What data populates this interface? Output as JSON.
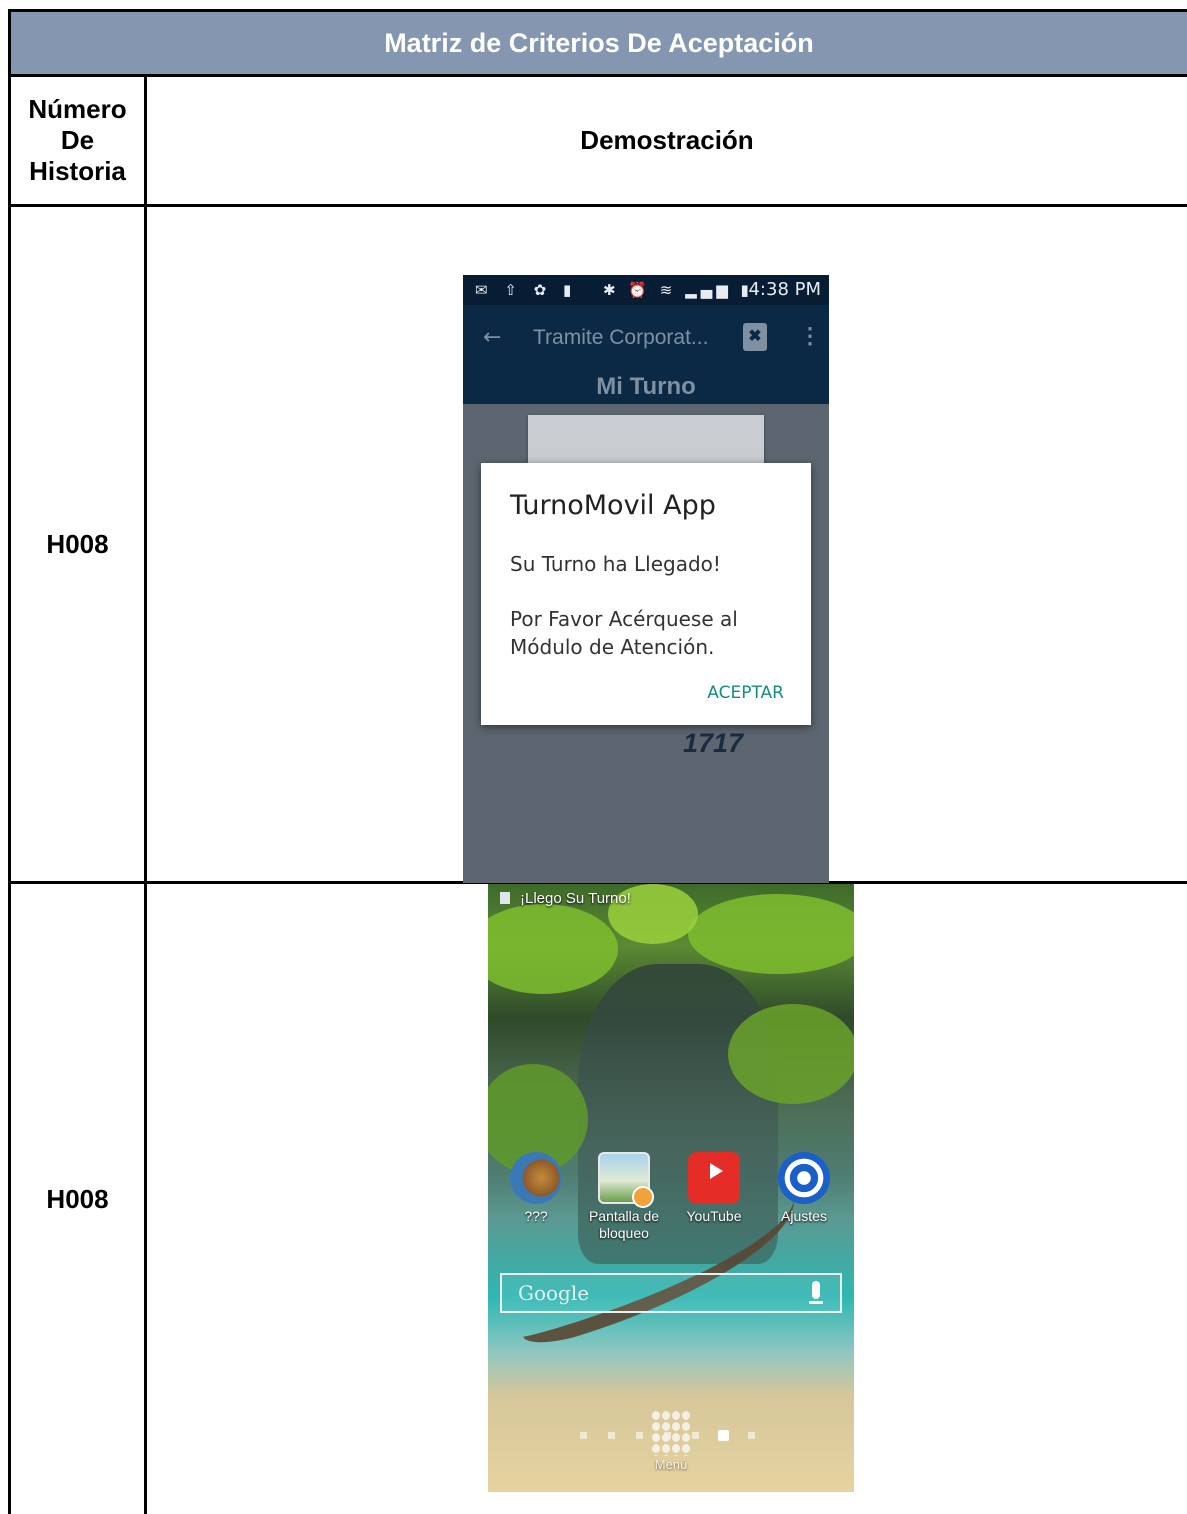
{
  "table": {
    "title": "Matriz de Criterios De Aceptación",
    "col_headers": {
      "number": [
        "Número",
        "De",
        "Historia"
      ],
      "demo": "Demostración"
    },
    "rows": [
      {
        "story": "H008"
      },
      {
        "story": "H008"
      }
    ]
  },
  "screenshot1": {
    "status_time": "4:38 PM",
    "status_icons_left": "✉ ⇧ ✿ ▮",
    "status_icons_right": "✱ ⏰ ≋ ▂▄▆ ▮",
    "back_icon": "←",
    "appbar_title": "Tramite Corporat...",
    "cancel_icon": "✖",
    "more_icon": "⋮",
    "subtitle": "Mi Turno",
    "ticket_number": "1717",
    "dialog": {
      "title": "TurnoMovil App",
      "line1": "Su Turno ha Llegado!",
      "line2": "Por Favor Acérquese al",
      "line3": "Módulo de Atención.",
      "button": "ACEPTAR"
    }
  },
  "screenshot2": {
    "notification": "¡Llego Su Turno!",
    "apps": [
      {
        "label": "???",
        "icon": "lion-icon"
      },
      {
        "label": "Pantalla de\nbloqueo",
        "label_1": "Pantalla de",
        "label_2": "bloqueo",
        "icon": "lock-screen-icon"
      },
      {
        "label": "YouTube",
        "icon": "youtube-icon"
      },
      {
        "label": "Ajustes",
        "icon": "settings-icon"
      }
    ],
    "search_brand": "Google",
    "menu_label": "Menú"
  },
  "colors": {
    "title_bar": "#8496b0",
    "app_header": "#0b2844",
    "dialog_accent": "#128d82"
  }
}
